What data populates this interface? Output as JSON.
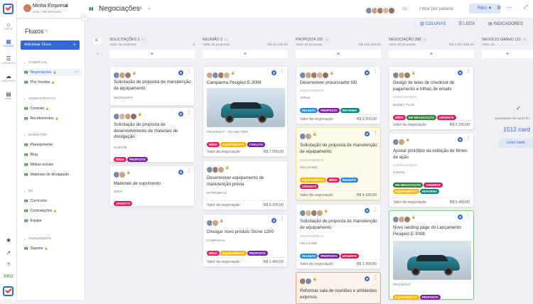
{
  "app": {
    "company": "Minha Empresa",
    "user": "Julia | Administrador",
    "page_title": "Negociações",
    "search_placeholder": "Filtrar por palavra",
    "filter_label": "Filtro",
    "pro_label": "PRO"
  },
  "rail": {
    "items": [
      {
        "icon": "⌂",
        "label": "INÍCIO"
      },
      {
        "icon": "▦",
        "label": "FLUXOS"
      },
      {
        "icon": "☰",
        "label": "CONTATOS"
      },
      {
        "icon": "☁",
        "label": "ARQUIVOS"
      },
      {
        "icon": "▤",
        "label": "MAIS"
      }
    ]
  },
  "views": {
    "columns": "COLUNAS",
    "list": "LISTA",
    "indicators": "INDICADORES"
  },
  "sidebar": {
    "title": "Fluxos",
    "add_label": "Adicionar Fluxo",
    "groups": [
      {
        "name": "COMERCIAL",
        "items": [
          "Negociações",
          "Pós Vendas"
        ]
      },
      {
        "name": "ADMINISTRATIVO",
        "items": [
          "Contrato",
          "Recebimentos"
        ]
      },
      {
        "name": "MARKETING",
        "items": [
          "Planejamento",
          "Blog",
          "Mídias sociais",
          "Materiais de divulgação"
        ]
      },
      {
        "name": "RH",
        "items": [
          "Currículos",
          "Contratações",
          "Equipe"
        ]
      },
      {
        "name": "ATENDIMENTO",
        "items": [
          "Suporte"
        ]
      }
    ]
  },
  "columns": [
    {
      "name": "SOLICITAÇÕES",
      "count": "3",
      "sub": "Valor da proposta",
      "sum": "0",
      "cards": [
        {
          "title": "Solicitação de proposta de manutenção de equipamento",
          "org": "MICROSOFT",
          "tags": [],
          "footer": "",
          "amount": ""
        },
        {
          "title": "Solicitação de proposta de desenvolvimento de materiais de divulgação",
          "org": "NUBANK",
          "tags": [
            "MÍDIA",
            "PROPOSTA"
          ],
          "footer": "",
          "amount": ""
        },
        {
          "title": "Materiais de suprimento",
          "org": "SONY",
          "tags": [
            "URGENTE"
          ],
          "footer": "",
          "amount": ""
        }
      ]
    },
    {
      "name": "REUNIÃO",
      "count": "3",
      "sub": "Valor da proposta",
      "sum": "R$ 15.100,00",
      "cards": [
        {
          "title": "Campanha Peugeot E-3008",
          "org": "PEUGEOUT · ANA BEATRIZ",
          "tags": [
            "MÍDIA",
            "EQUIPAMENTO",
            "CRIAÇÃO"
          ],
          "footer": "Valor da negociação",
          "amount": "R$ 7.500,00"
        },
        {
          "title": "Desenvolver equipamento de manutenção prévia",
          "org": "PETROBRAS",
          "tags": [],
          "footer": "Valor da negociação",
          "amount": "R$ 6.200,00"
        },
        {
          "title": "Divulgar novo produto Stone 1200",
          "org": "COMPAGAS",
          "tags": [
            "MÍDIA",
            "EQUIPAMENTO",
            "PROPOSTA"
          ],
          "footer": "Valor da negociação",
          "amount": "R$ 1.400,00"
        }
      ]
    },
    {
      "name": "PROPOSTA",
      "count": "150",
      "sub": "Valor da proposta",
      "sum": "R$ 145.250,00",
      "cards": [
        {
          "title": "Desenvolver processador M2",
          "code": "20220204000676",
          "org": "APPLE",
          "tags": [
            "REUNIÃO",
            "PROPOSTA",
            "REFORMA"
          ],
          "footer": "Valor da negociação",
          "amount": "R$ 3.200,00"
        },
        {
          "title": "Solicitação de proposta de manutenção de equipamento",
          "code": "20220204000676",
          "org": "HELLSONG",
          "tags": [
            "EQUIPAMENTO",
            "MÍDIA",
            "REUNIÃO",
            "URGENTE"
          ],
          "footer": "Valor da negociação",
          "amount": "R$ 4.100,00"
        },
        {
          "title": "Solicitação de proposta de manutenção de equipamento",
          "code": "20220204000676",
          "org": "HELLSONG",
          "tags": [
            "REUNIÃO",
            "PROPOSTA",
            "URGENTE"
          ],
          "footer": "Valor da negociação",
          "amount": "R$ 1.300,00"
        },
        {
          "title": "Reformar sala de reuniões e ambientes externos",
          "org": "",
          "tags": [],
          "footer": "",
          "amount": ""
        }
      ]
    },
    {
      "name": "NEGOCIAÇÃO",
      "count": "398",
      "sub": "Valor da proposta",
      "sum": "R$ 1.257.655,22",
      "cards": [
        {
          "title": "Design de telas de checkout de pagamento e trilhas de emails",
          "code": "20220204000676",
          "org": "DISNEY PLUS",
          "tags": [
            "MÍDIA",
            "EM NEGOCIAÇÃO",
            "URGENTE"
          ],
          "footer": "Valor da negociação",
          "amount": "R$ 5.200,00"
        },
        {
          "title": "Ajustar protótipo da exibição de filmes de ação",
          "code": "20220204000676",
          "org": "CANON",
          "tags": [
            "EM NEGOCIAÇÃO",
            "URGENTE",
            "EQUIPAMENTO",
            "REFORMA"
          ],
          "footer": "Valor da negociação",
          "amount": "R$ 5.400,00"
        },
        {
          "title": "Novo landing page do Lançamento Peugeot E-3008",
          "org": "PEUGEOUT",
          "tags": [
            "EQUIPAMENTO",
            "PROPOSTA"
          ],
          "footer": "",
          "amount": ""
        }
      ]
    }
  ],
  "right_panel": {
    "title": "NEGÓCIO GANHO",
    "count": "110",
    "sub": "Valor da",
    "label": "Quantidade de cards fin",
    "total": "1512 card",
    "button": "Listar cards"
  }
}
